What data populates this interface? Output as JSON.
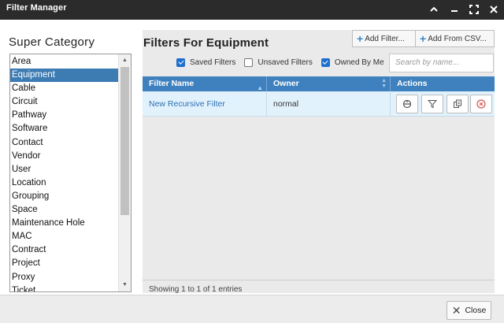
{
  "window": {
    "title": "Filter Manager",
    "controls": [
      "chevron-up",
      "minimize",
      "maximize",
      "close"
    ]
  },
  "left": {
    "heading": "Super Category",
    "selected_index": 1,
    "items": [
      "Area",
      "Equipment",
      "Cable",
      "Circuit",
      "Pathway",
      "Software",
      "Contact",
      "Vendor",
      "User",
      "Location",
      "Grouping",
      "Space",
      "Maintenance Hole",
      "MAC",
      "Contract",
      "Project",
      "Proxy",
      "Ticket"
    ]
  },
  "right": {
    "heading": "Filters For Equipment",
    "add_filter_label": "Add Filter...",
    "add_csv_label": "Add From CSV...",
    "checkboxes": {
      "saved": {
        "label": "Saved Filters",
        "checked": true
      },
      "unsaved": {
        "label": "Unsaved Filters",
        "checked": false
      },
      "owned": {
        "label": "Owned By Me",
        "checked": true
      }
    },
    "search_placeholder": "Search by name...",
    "table": {
      "headers": {
        "name": "Filter Name",
        "owner": "Owner",
        "actions": "Actions"
      },
      "rows": [
        {
          "name": "New Recursive Filter",
          "owner": "normal"
        }
      ],
      "action_icons": [
        "hierarchy-icon",
        "filter-icon",
        "copy-icon",
        "delete-icon"
      ]
    },
    "info": "Showing 1 to 1 of 1 entries"
  },
  "footer": {
    "close_label": "Close"
  },
  "colors": {
    "titlebar": "#2b2b2b",
    "selected": "#3d7bb3",
    "table_header": "#3f81bf",
    "row_bg": "#e2f2fc",
    "delete": "#d9534f"
  }
}
